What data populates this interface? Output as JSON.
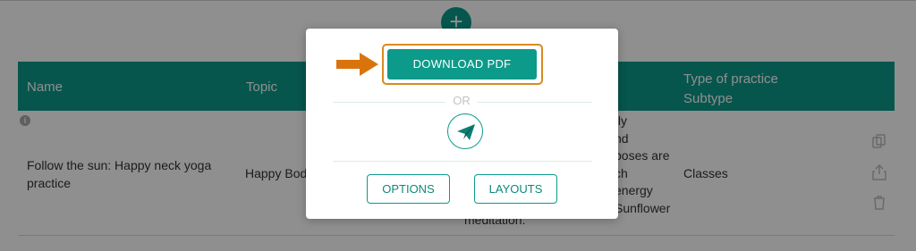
{
  "add_button": {
    "label": "+"
  },
  "table": {
    "headers": {
      "name": "Name",
      "topic": "Topic",
      "type": "Type of practice",
      "subtype": "Subtype"
    },
    "row": {
      "name": "Follow the sun: Happy neck yoga practice",
      "topic": "Happy Body",
      "description_lines": [
        "tly",
        "nd",
        "poses are",
        "ch",
        "energy",
        "Sunflower"
      ],
      "description_end": "meditation.",
      "type": "Classes"
    },
    "info_icon": "i"
  },
  "row_icons": [
    "copy-icon",
    "share-icon",
    "trash-icon"
  ],
  "modal": {
    "download_label": "DOWNLOAD PDF",
    "or_label": "OR",
    "send_icon": "paper-plane-icon",
    "options_label": "OPTIONS",
    "layouts_label": "LAYOUTS"
  },
  "colors": {
    "accent": "#0c9a8a",
    "highlight": "#d98a1e"
  }
}
